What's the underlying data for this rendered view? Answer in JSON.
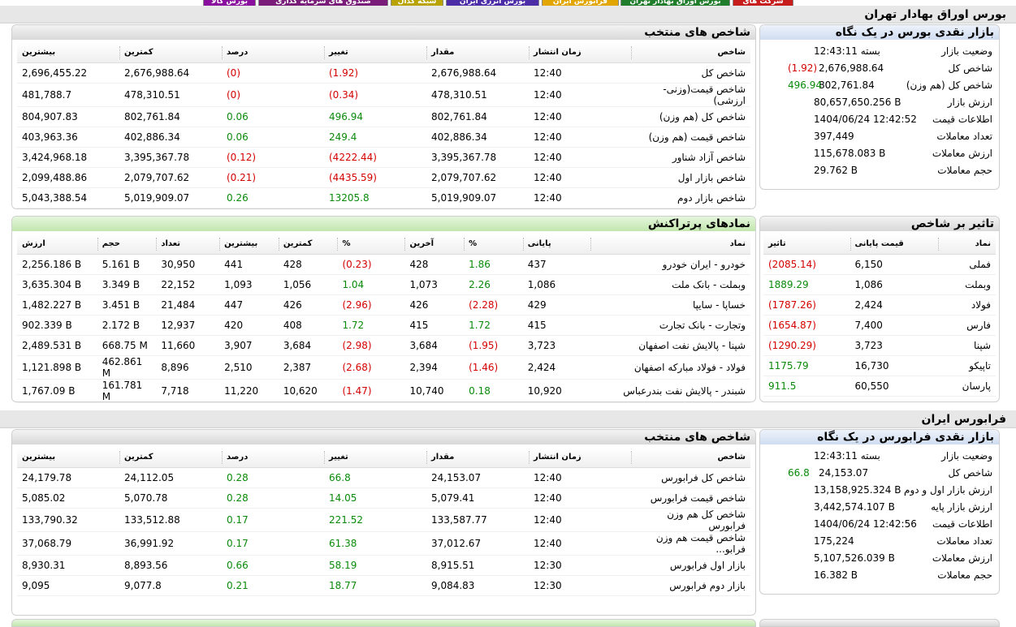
{
  "top_tabs": [
    {
      "label": "بورس کالا",
      "color": "#8a0f9e"
    },
    {
      "label": "صندوق های سرمایه گذاری",
      "color": "#7a1c7a"
    },
    {
      "label": "شبکه کدال",
      "color": "#b8a300"
    },
    {
      "label": "بورس انرژی ایران",
      "color": "#4d2ca8"
    },
    {
      "label": "فرابورس ایران",
      "color": "#e3a600"
    },
    {
      "label": "بورس اوراق بهادار تهران",
      "color": "#1f7d2b"
    },
    {
      "label": "شرکت های",
      "color": "#c81d1d"
    }
  ],
  "tse": {
    "section_title": "بورس اوراق بهادار تهران",
    "overview": {
      "title": "بازار نقدی بورس در یک نگاه",
      "rows": [
        {
          "label": "وضعیت بازار",
          "value": "بسته 12:43:11",
          "change": ""
        },
        {
          "label": "شاخص کل",
          "value": "2,676,988.64",
          "change": "(1.92)",
          "dir": "neg"
        },
        {
          "label": "شاخص کل (هم وزن)",
          "value": "802,761.84",
          "change": "496.94",
          "dir": "pos"
        },
        {
          "label": "ارزش بازار",
          "value": "80,657,650.256 B",
          "change": ""
        },
        {
          "label": "اطلاعات قیمت",
          "value": "1404/06/24 12:42:52",
          "change": ""
        },
        {
          "label": "تعداد معاملات",
          "value": "397,449",
          "change": ""
        },
        {
          "label": "ارزش معاملات",
          "value": "115,678.083 B",
          "change": ""
        },
        {
          "label": "حجم معاملات",
          "value": "29.762 B",
          "change": ""
        }
      ]
    },
    "indices": {
      "title": "شاخص های منتخب",
      "headers": [
        "شاخص",
        "زمان انتشار",
        "مقدار",
        "تغییر",
        "درصد",
        "کمترین",
        "بیشترین"
      ],
      "rows": [
        {
          "name": "شاخص کل",
          "time": "12:40",
          "value": "2,676,988.64",
          "change": "(1.92)",
          "pct": "(0)",
          "min": "2,676,988.64",
          "max": "2,696,455.22",
          "dir": "neg"
        },
        {
          "name": "شاخص قیمت(وزنی-ارزشی)",
          "time": "12:40",
          "value": "478,310.51",
          "change": "(0.34)",
          "pct": "(0)",
          "min": "478,310.51",
          "max": "481,788.7",
          "dir": "neg"
        },
        {
          "name": "شاخص کل (هم وزن)",
          "time": "12:40",
          "value": "802,761.84",
          "change": "496.94",
          "pct": "0.06",
          "min": "802,761.84",
          "max": "804,907.83",
          "dir": "pos"
        },
        {
          "name": "شاخص قیمت (هم وزن)",
          "time": "12:40",
          "value": "402,886.34",
          "change": "249.4",
          "pct": "0.06",
          "min": "402,886.34",
          "max": "403,963.36",
          "dir": "pos"
        },
        {
          "name": "شاخص آزاد شناور",
          "time": "12:40",
          "value": "3,395,367.78",
          "change": "(4222.44)",
          "pct": "(0.12)",
          "min": "3,395,367.78",
          "max": "3,424,968.18",
          "dir": "neg"
        },
        {
          "name": "شاخص بازار اول",
          "time": "12:40",
          "value": "2,079,707.62",
          "change": "(4435.59)",
          "pct": "(0.21)",
          "min": "2,079,707.62",
          "max": "2,099,488.86",
          "dir": "neg"
        },
        {
          "name": "شاخص بازار دوم",
          "time": "12:40",
          "value": "5,019,909.07",
          "change": "13205.8",
          "pct": "0.26",
          "min": "5,019,909.07",
          "max": "5,043,388.54",
          "dir": "pos"
        }
      ]
    },
    "impact": {
      "title": "تاثیر بر شاخص",
      "headers": [
        "نماد",
        "قیمت پایانی",
        "تاثیر"
      ],
      "rows": [
        {
          "symbol": "فملی",
          "close": "6,150",
          "impact": "(2085.14)",
          "dir": "neg"
        },
        {
          "symbol": "وبملت",
          "close": "1,086",
          "impact": "1889.29",
          "dir": "pos"
        },
        {
          "symbol": "فولاد",
          "close": "2,424",
          "impact": "(1787.26)",
          "dir": "neg"
        },
        {
          "symbol": "فارس",
          "close": "7,400",
          "impact": "(1654.87)",
          "dir": "neg"
        },
        {
          "symbol": "شپنا",
          "close": "3,723",
          "impact": "(1290.29)",
          "dir": "neg"
        },
        {
          "symbol": "تاپیکو",
          "close": "16,730",
          "impact": "1175.79",
          "dir": "pos"
        },
        {
          "symbol": "پارسان",
          "close": "60,550",
          "impact": "911.5",
          "dir": "pos"
        }
      ]
    },
    "active": {
      "title": "نمادهای پرتراکنش",
      "headers": [
        "نماد",
        "پایانی",
        "%",
        "آخرین",
        "%",
        "کمترین",
        "بیشترین",
        "تعداد",
        "حجم",
        "ارزش"
      ],
      "rows": [
        {
          "name": "خودرو - ایران خودرو",
          "close": "437",
          "cpct": "1.86",
          "cdir": "pos",
          "last": "428",
          "lpct": "(0.23)",
          "ldir": "neg",
          "min": "428",
          "max": "441",
          "count": "30,950",
          "vol": "5.161 B",
          "val": "2,256.186 B"
        },
        {
          "name": "وبملت - بانک ملت",
          "close": "1,086",
          "cpct": "2.26",
          "cdir": "pos",
          "last": "1,073",
          "lpct": "1.04",
          "ldir": "pos",
          "min": "1,056",
          "max": "1,093",
          "count": "22,152",
          "vol": "3.349 B",
          "val": "3,635.304 B"
        },
        {
          "name": "خساپا - سایپا",
          "close": "429",
          "cpct": "(2.28)",
          "cdir": "neg",
          "last": "426",
          "lpct": "(2.96)",
          "ldir": "neg",
          "min": "426",
          "max": "447",
          "count": "21,484",
          "vol": "3.451 B",
          "val": "1,482.227 B"
        },
        {
          "name": "وتجارت - بانک تجارت",
          "close": "415",
          "cpct": "1.72",
          "cdir": "pos",
          "last": "415",
          "lpct": "1.72",
          "ldir": "pos",
          "min": "408",
          "max": "420",
          "count": "12,937",
          "vol": "2.172 B",
          "val": "902.339 B"
        },
        {
          "name": "شپنا - پالایش نفت اصفهان",
          "close": "3,723",
          "cpct": "(1.95)",
          "cdir": "neg",
          "last": "3,684",
          "lpct": "(2.98)",
          "ldir": "neg",
          "min": "3,684",
          "max": "3,907",
          "count": "11,660",
          "vol": "668.75 M",
          "val": "2,489.531 B"
        },
        {
          "name": "فولاد - فولاد مبارکه اصفهان",
          "close": "2,424",
          "cpct": "(1.46)",
          "cdir": "neg",
          "last": "2,394",
          "lpct": "(2.68)",
          "ldir": "neg",
          "min": "2,387",
          "max": "2,510",
          "count": "8,896",
          "vol": "462.861 M",
          "val": "1,121.898 B"
        },
        {
          "name": "شبندر - پالایش نفت بندرعباس",
          "close": "10,920",
          "cpct": "0.18",
          "cdir": "pos",
          "last": "10,740",
          "lpct": "(1.47)",
          "ldir": "neg",
          "min": "10,620",
          "max": "11,220",
          "count": "7,718",
          "vol": "161.781 M",
          "val": "1,767.09 B"
        }
      ]
    }
  },
  "ifb": {
    "section_title": "فرابورس ایران",
    "overview": {
      "title": "بازار نقدی فرابورس در یک نگاه",
      "rows": [
        {
          "label": "وضعیت بازار",
          "value": "بسته 12:43:11",
          "change": ""
        },
        {
          "label": "شاخص کل",
          "value": "24,153.07",
          "change": "66.8",
          "dir": "pos"
        },
        {
          "label": "ارزش بازار اول و دوم",
          "value": "13,158,925.324 B",
          "change": ""
        },
        {
          "label": "ارزش بازار پایه",
          "value": "3,442,574.107 B",
          "change": ""
        },
        {
          "label": "اطلاعات قیمت",
          "value": "1404/06/24 12:42:56",
          "change": ""
        },
        {
          "label": "تعداد معاملات",
          "value": "175,224",
          "change": ""
        },
        {
          "label": "ارزش معاملات",
          "value": "5,107,526.039 B",
          "change": ""
        },
        {
          "label": "حجم معاملات",
          "value": "16.382 B",
          "change": ""
        }
      ]
    },
    "indices": {
      "title": "شاخص های منتخب",
      "headers": [
        "شاخص",
        "زمان انتشار",
        "مقدار",
        "تغییر",
        "درصد",
        "کمترین",
        "بیشترین"
      ],
      "rows": [
        {
          "name": "شاخص کل فرابورس",
          "time": "12:40",
          "value": "24,153.07",
          "change": "66.8",
          "pct": "0.28",
          "min": "24,112.05",
          "max": "24,179.78",
          "dir": "pos"
        },
        {
          "name": "شاخص قیمت فرابورس",
          "time": "12:40",
          "value": "5,079.41",
          "change": "14.05",
          "pct": "0.28",
          "min": "5,070.78",
          "max": "5,085.02",
          "dir": "pos"
        },
        {
          "name": "شاخص کل هم وزن فرابورس",
          "time": "12:40",
          "value": "133,587.77",
          "change": "221.52",
          "pct": "0.17",
          "min": "133,512.88",
          "max": "133,790.32",
          "dir": "pos"
        },
        {
          "name": "شاخص قیمت هم وزن فرابو...",
          "time": "12:40",
          "value": "37,012.67",
          "change": "61.38",
          "pct": "0.17",
          "min": "36,991.92",
          "max": "37,068.79",
          "dir": "pos"
        },
        {
          "name": "بازار اول فرابورس",
          "time": "12:30",
          "value": "8,915.51",
          "change": "58.19",
          "pct": "0.66",
          "min": "8,893.56",
          "max": "8,930.31",
          "dir": "pos"
        },
        {
          "name": "بازار دوم فرابورس",
          "time": "12:30",
          "value": "9,084.83",
          "change": "18.77",
          "pct": "0.21",
          "min": "9,077.8",
          "max": "9,095",
          "dir": "pos"
        }
      ]
    }
  }
}
